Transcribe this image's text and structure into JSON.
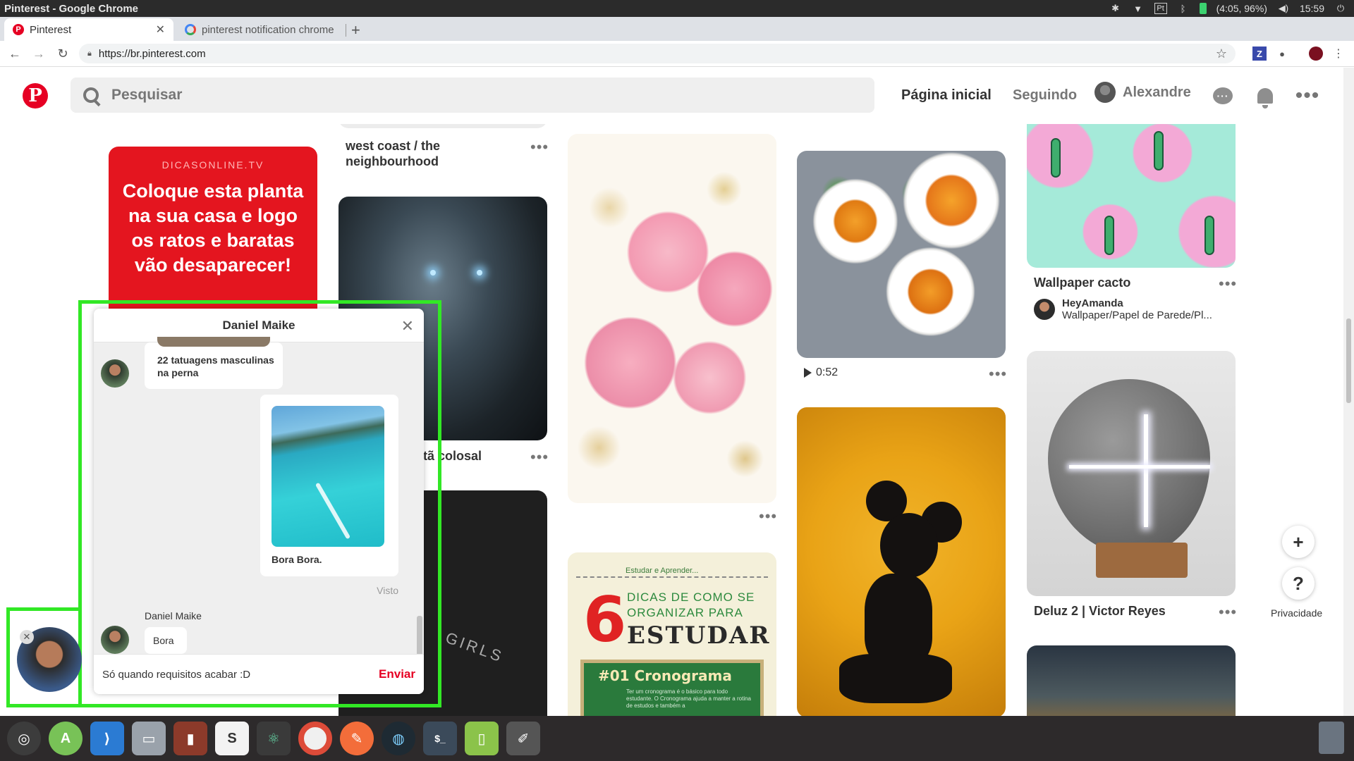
{
  "os": {
    "window_title": "Pinterest - Google Chrome",
    "battery": "(4:05, 96%)",
    "clock": "15:59"
  },
  "browser": {
    "tabs": [
      {
        "label": "Pinterest"
      },
      {
        "label": "pinterest notification chrome"
      }
    ],
    "url": "https://br.pinterest.com"
  },
  "header": {
    "search_placeholder": "Pesquisar",
    "home_label": "Página inicial",
    "following_label": "Seguindo",
    "user_name": "Alexandre"
  },
  "pins": {
    "red": {
      "small": "DICASONLINE.TV",
      "big": "Coloque esta planta na sua casa e logo os ratos e baratas vão desaparecer!"
    },
    "col2_title": "west coast / the neighbourhood",
    "col2_title2": "tã colosal",
    "col2_dark2_text": "GIRLS",
    "dicas": {
      "header": "Estudar e Aprender...",
      "six": "6",
      "line1": "DICAS DE COMO SE",
      "line2": "ORGANIZAR PARA",
      "line3": "ESTUDAR",
      "board_title": "#01 Cronograma",
      "board_text": "Ter um cronograma é o básico para todo estudante. O Cronograma ajuda a manter a rotina de estudos e também a"
    },
    "video_duration": "0:52",
    "cacto": {
      "title": "Wallpaper cacto",
      "user": "HeyAmanda",
      "board": "Wallpaper/Papel de Parede/Pl..."
    },
    "stone_title": "Deluz 2 | Victor Reyes",
    "more": "•••"
  },
  "chat": {
    "name": "Daniel Maike",
    "card1_title": "22 tatuagens masculinas na perna",
    "card2_title": "Bora Bora.",
    "seen": "Visto",
    "sender": "Daniel Maike",
    "last_message": "Bora",
    "input_value": "Só quando requisitos acabar :D",
    "send_label": "Enviar"
  },
  "floating": {
    "add": "+",
    "help": "?",
    "privacy": "Privacidade"
  }
}
